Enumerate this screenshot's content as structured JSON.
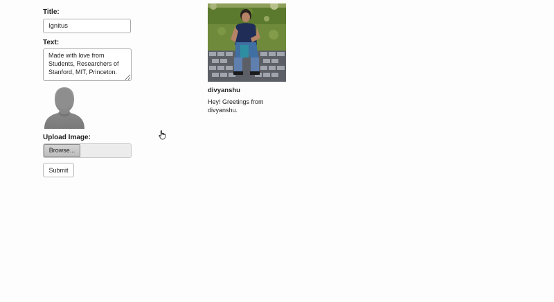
{
  "form": {
    "title_label": "Title:",
    "title_value": "Ignitus",
    "text_label": "Text:",
    "text_value": "Made with love from Students, Researchers of Stanford, MIT, Princeton.",
    "avatar_icon": "default-user-avatar",
    "upload_label": "Upload Image:",
    "browse_label": "Browse...",
    "submit_label": "Submit"
  },
  "post": {
    "author": "divyanshu",
    "message": "Hey! Greetings from divyanshu."
  },
  "cursor": {
    "icon": "hand-pointer-icon"
  }
}
